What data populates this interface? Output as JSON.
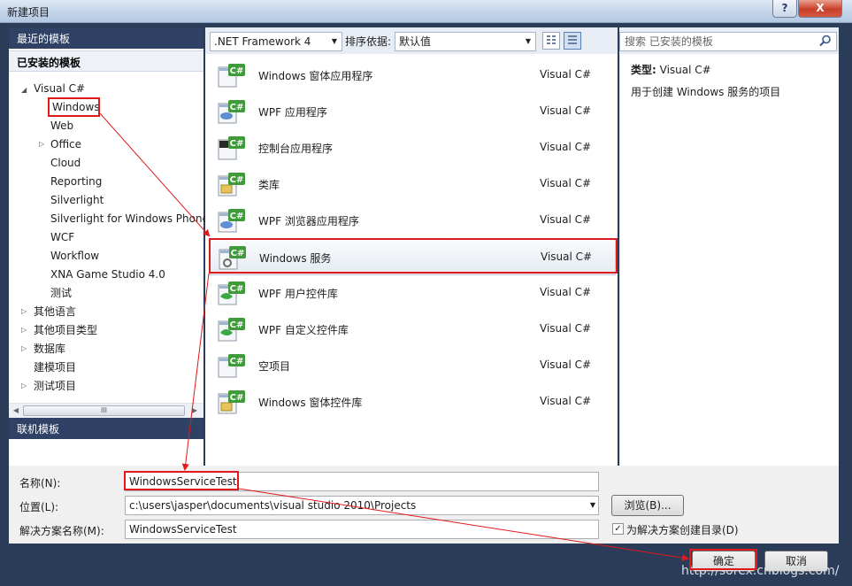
{
  "window": {
    "title": "新建项目",
    "help_glyph": "?",
    "close_glyph": "X"
  },
  "left": {
    "recent_templates": "最近的模板",
    "installed_templates": "已安装的模板",
    "online_templates": "联机模板",
    "tree": {
      "root": "Visual C#",
      "children": [
        "Windows",
        "Web",
        "Office",
        "Cloud",
        "Reporting",
        "Silverlight",
        "Silverlight for Windows Phone",
        "WCF",
        "Workflow",
        "XNA Game Studio 4.0",
        "测试"
      ],
      "other": [
        "其他语言",
        "其他项目类型",
        "数据库",
        "建模项目",
        "测试项目"
      ]
    },
    "scroll_thumb": "III"
  },
  "toolbar": {
    "framework": ".NET Framework 4",
    "sort_label": "排序依据:",
    "sort_value": "默认值"
  },
  "search": {
    "placeholder": "搜索 已安装的模板"
  },
  "templates": [
    {
      "name": "Windows 窗体应用程序",
      "lang": "Visual C#"
    },
    {
      "name": "WPF 应用程序",
      "lang": "Visual C#"
    },
    {
      "name": "控制台应用程序",
      "lang": "Visual C#"
    },
    {
      "name": "类库",
      "lang": "Visual C#"
    },
    {
      "name": "WPF 浏览器应用程序",
      "lang": "Visual C#"
    },
    {
      "name": "Windows 服务",
      "lang": "Visual C#"
    },
    {
      "name": "WPF 用户控件库",
      "lang": "Visual C#"
    },
    {
      "name": "WPF 自定义控件库",
      "lang": "Visual C#"
    },
    {
      "name": "空项目",
      "lang": "Visual C#"
    },
    {
      "name": "Windows 窗体控件库",
      "lang": "Visual C#"
    }
  ],
  "description": {
    "type_label": "类型:",
    "type_value": "Visual C#",
    "text": "用于创建 Windows 服务的项目"
  },
  "form": {
    "name_label": "名称(N):",
    "name_value": "WindowsServiceTest",
    "location_label": "位置(L):",
    "location_value": "c:\\users\\jasper\\documents\\visual studio 2010\\Projects",
    "solution_label": "解决方案名称(M):",
    "solution_value": "WindowsServiceTest",
    "browse_label": "浏览(B)...",
    "create_dir_label": "为解决方案创建目录(D)",
    "create_dir_checked": true,
    "ok_label": "确定",
    "cancel_label": "取消"
  },
  "watermark": "http://sorex.cnblogs.com/",
  "colors": {
    "accent_red": "#e0191a",
    "header_blue": "#2f4266",
    "csharp_green": "#3f9a3a"
  }
}
